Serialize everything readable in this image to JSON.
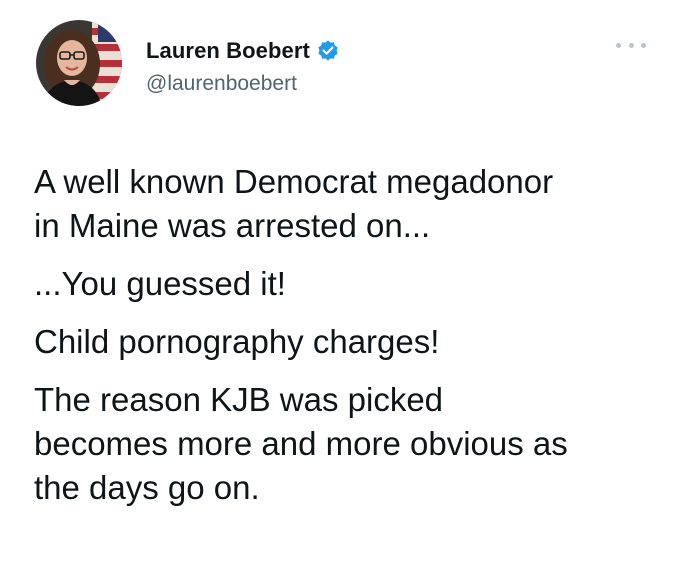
{
  "tweet": {
    "author": {
      "display_name": "Lauren Boebert",
      "handle": "@laurenboebert",
      "verified_icon": "verified-badge-icon",
      "avatar_icon": "avatar-photo"
    },
    "more_icon": "more-options-icon",
    "paragraphs": [
      "A well known Democrat megadonor\nin Maine was arrested on...",
      "...You guessed it!",
      "Child pornography charges!",
      "The reason KJB was picked\nbecomes more and more obvious as\nthe days go on."
    ]
  },
  "colors": {
    "text": "#0f1419",
    "secondary": "#536471",
    "verified_blue": "#1d9bf0",
    "background": "#ffffff"
  }
}
